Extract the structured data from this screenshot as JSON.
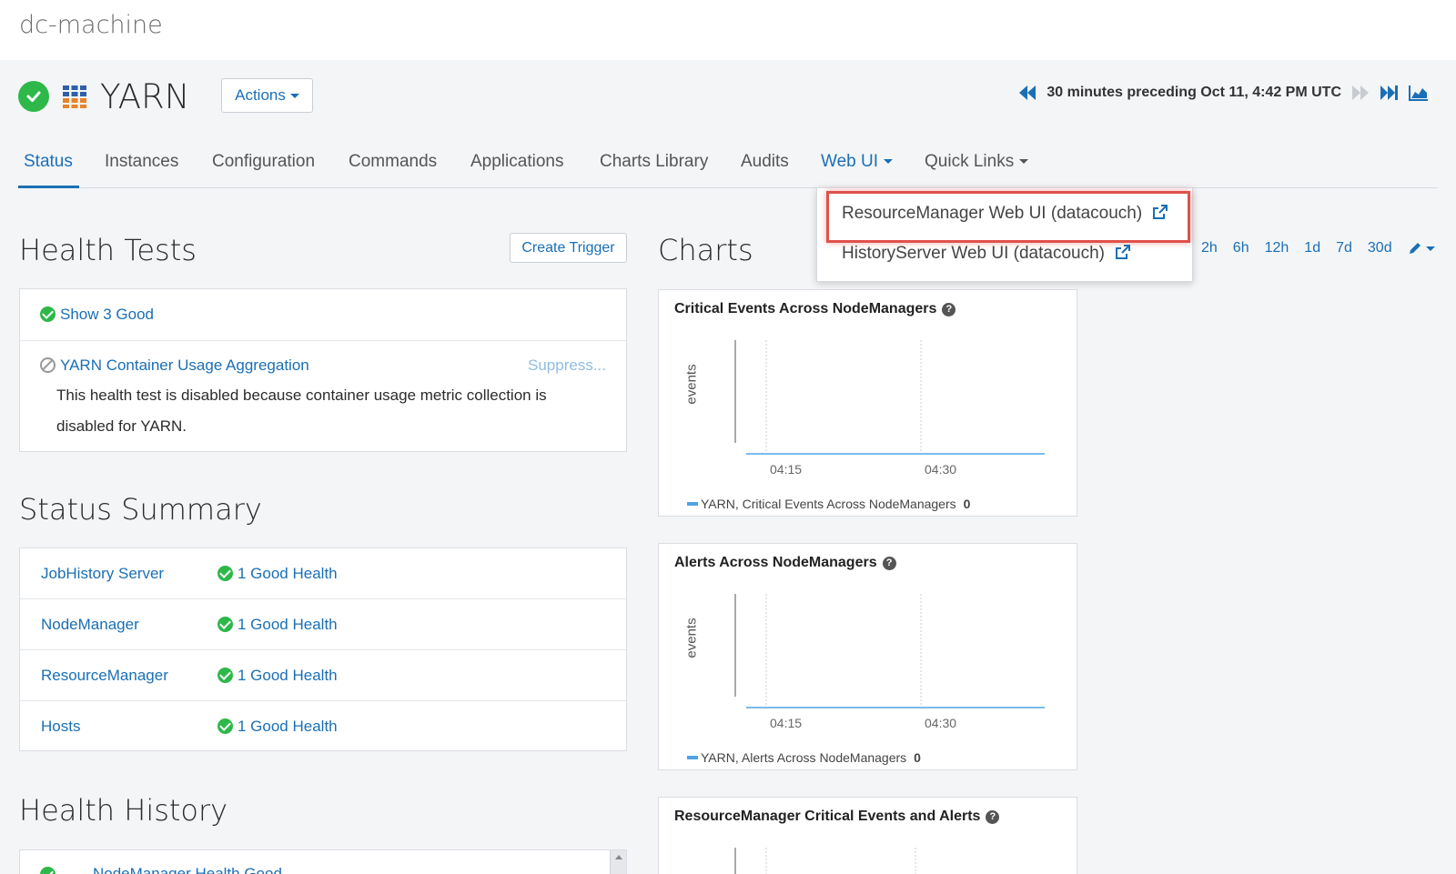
{
  "topbar": {
    "host": "dc-machine"
  },
  "service": {
    "name": "YARN",
    "actions_label": "Actions"
  },
  "timebar": {
    "range_text": "30 minutes preceding Oct 11, 4:42 PM UTC"
  },
  "tabs": [
    {
      "label": "Status"
    },
    {
      "label": "Instances"
    },
    {
      "label": "Configuration"
    },
    {
      "label": "Commands"
    },
    {
      "label": "Applications"
    },
    {
      "label": "Charts Library"
    },
    {
      "label": "Audits"
    },
    {
      "label": "Web UI"
    },
    {
      "label": "Quick Links"
    }
  ],
  "web_ui_menu": {
    "items": [
      {
        "label": "ResourceManager Web UI (datacouch)"
      },
      {
        "label": "HistoryServer Web UI (datacouch)"
      }
    ]
  },
  "health_tests": {
    "title": "Health Tests",
    "create_trigger_label": "Create Trigger",
    "show_good": "Show 3 Good",
    "disabled_test": {
      "name": "YARN Container Usage Aggregation",
      "suppress": "Suppress...",
      "description_line1": "This health test is disabled because container usage metric collection is",
      "description_line2": "disabled for YARN."
    }
  },
  "status_summary": {
    "title": "Status Summary",
    "rows": [
      {
        "role": "JobHistory Server",
        "health": "1 Good Health"
      },
      {
        "role": "NodeManager",
        "health": "1 Good Health"
      },
      {
        "role": "ResourceManager",
        "health": "1 Good Health"
      },
      {
        "role": "Hosts",
        "health": "1 Good Health"
      }
    ]
  },
  "health_history": {
    "title": "Health History",
    "first_item": "NodeManager Health Good"
  },
  "charts": {
    "title": "Charts",
    "range_links": [
      "2h",
      "6h",
      "12h",
      "1d",
      "7d",
      "30d"
    ],
    "items": [
      {
        "title": "Critical Events Across NodeManagers",
        "ylabel": "events",
        "ticks": [
          "04:15",
          "04:30"
        ],
        "legend": "YARN, Critical Events Across NodeManagers",
        "legend_value": "0"
      },
      {
        "title": "Alerts Across NodeManagers",
        "ylabel": "events",
        "ticks": [
          "04:15",
          "04:30"
        ],
        "legend": "YARN, Alerts Across NodeManagers",
        "legend_value": "0"
      },
      {
        "title": "ResourceManager Critical Events and Alerts"
      }
    ]
  },
  "colors": {
    "accent": "#1a6fb5",
    "good": "#2eb84a",
    "highlight": "#e0524a"
  }
}
